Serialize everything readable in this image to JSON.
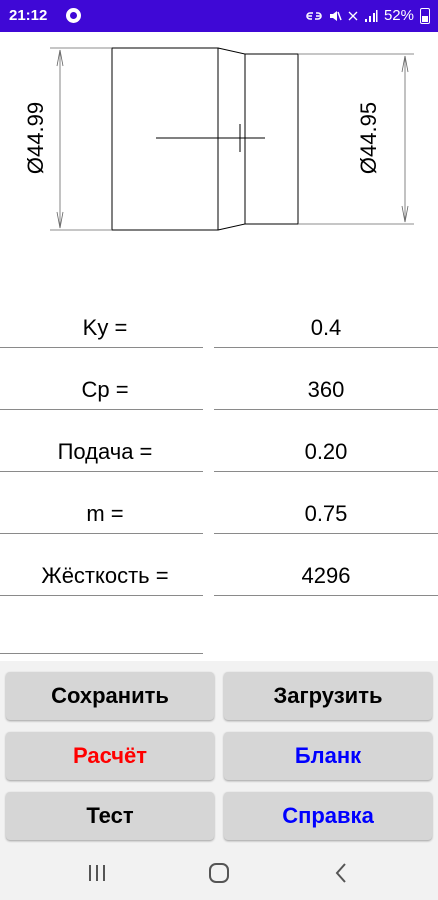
{
  "status_bar": {
    "time": "21:12",
    "battery": "52%",
    "icons": [
      "app-notification-icon",
      "link-icon",
      "mute-icon",
      "wifi-icon",
      "signal-icon",
      "battery-icon"
    ],
    "color": "#3f08d6"
  },
  "drawing": {
    "left_dimension": "Ø44.99",
    "right_dimension": "Ø44.95"
  },
  "params": [
    {
      "label": "Ky =",
      "value": "0.4"
    },
    {
      "label": "Cp =",
      "value": "360"
    },
    {
      "label": "Подача =",
      "value": "0.20"
    },
    {
      "label": "m =",
      "value": "0.75"
    },
    {
      "label": "Жёсткость =",
      "value": "4296"
    }
  ],
  "buttons": {
    "save": {
      "label": "Сохранить",
      "color": "#000000"
    },
    "load": {
      "label": "Загрузить",
      "color": "#000000"
    },
    "calc": {
      "label": "Расчёт",
      "color": "#ff0000"
    },
    "blank": {
      "label": "Бланк",
      "color": "#0000ff"
    },
    "test": {
      "label": "Тест",
      "color": "#000000"
    },
    "help": {
      "label": "Справка",
      "color": "#0000ff"
    }
  },
  "nav": [
    "recents-icon",
    "home-icon",
    "back-icon"
  ]
}
